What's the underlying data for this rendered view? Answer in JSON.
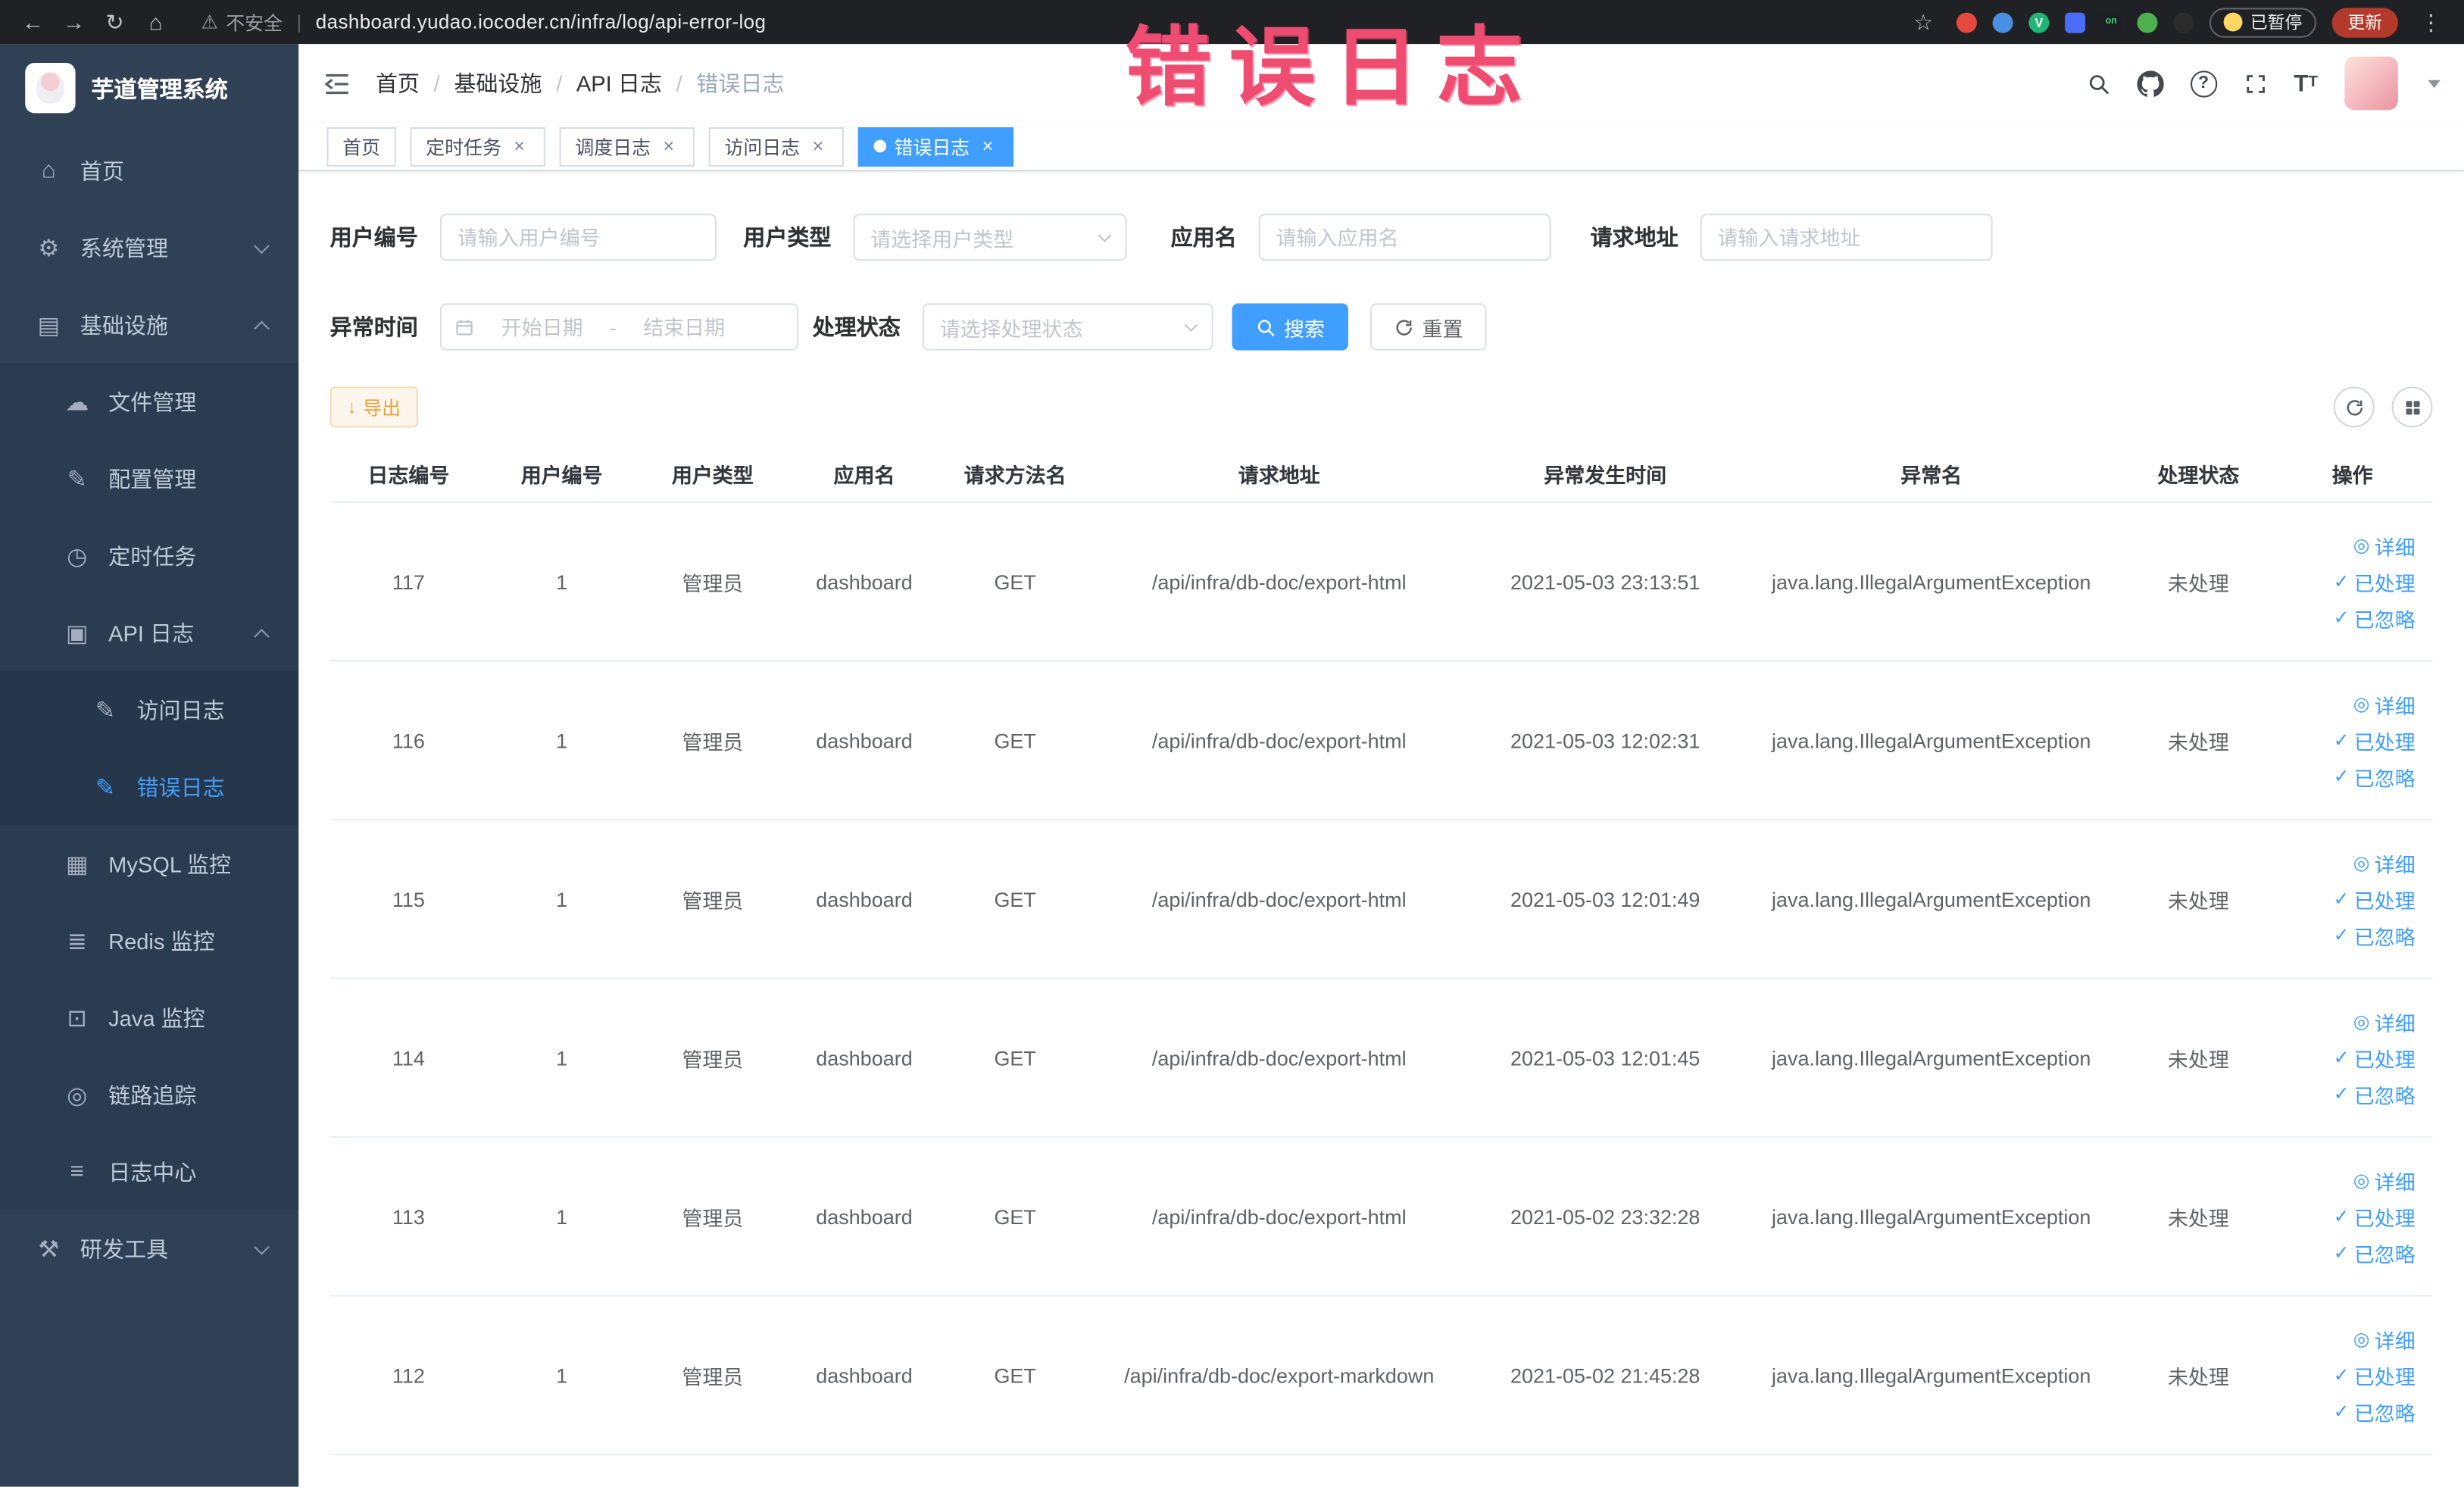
{
  "browser": {
    "security_label": "不安全",
    "url": "dashboard.yudao.iocoder.cn/infra/log/api-error-log",
    "paused_badge": "已暂停",
    "update_button": "更新"
  },
  "annotation": {
    "title": "错误日志"
  },
  "icons": {
    "back": "←",
    "forward": "→",
    "reload": "↻",
    "home": "⌂",
    "warning": "⚠",
    "star": "☆",
    "menu": "⋮",
    "divider": "|",
    "view": "◎",
    "check": "✓",
    "download": "↓"
  },
  "sidebar": {
    "logo_title": "芋道管理系统",
    "items": [
      {
        "label": "首页",
        "icon": "⌂"
      },
      {
        "label": "系统管理",
        "icon": "⚙"
      },
      {
        "label": "基础设施",
        "icon": "▤"
      },
      {
        "label": "文件管理",
        "icon": "☁"
      },
      {
        "label": "配置管理",
        "icon": "✎"
      },
      {
        "label": "定时任务",
        "icon": "◷"
      },
      {
        "label": "API 日志",
        "icon": "▣"
      },
      {
        "label": "访问日志",
        "icon": "✎"
      },
      {
        "label": "错误日志",
        "icon": "✎"
      },
      {
        "label": "MySQL 监控",
        "icon": "▦"
      },
      {
        "label": "Redis 监控",
        "icon": "≣"
      },
      {
        "label": "Java 监控",
        "icon": "⊡"
      },
      {
        "label": "链路追踪",
        "icon": "◎"
      },
      {
        "label": "日志中心",
        "icon": "≡"
      },
      {
        "label": "研发工具",
        "icon": "⚒"
      }
    ]
  },
  "breadcrumb": {
    "separator": "/",
    "items": [
      "首页",
      "基础设施",
      "API 日志",
      "错误日志"
    ]
  },
  "tabsbar": {
    "close_glyph": "×",
    "tabs": [
      {
        "label": "首页"
      },
      {
        "label": "定时任务"
      },
      {
        "label": "调度日志"
      },
      {
        "label": "访问日志"
      },
      {
        "label": "错误日志"
      }
    ]
  },
  "filters": {
    "user_id": {
      "label": "用户编号",
      "placeholder": "请输入用户编号"
    },
    "user_type": {
      "label": "用户类型",
      "placeholder": "请选择用户类型"
    },
    "app_name": {
      "label": "应用名",
      "placeholder": "请输入应用名"
    },
    "request_url": {
      "label": "请求地址",
      "placeholder": "请输入请求地址"
    },
    "exception_time": {
      "label": "异常时间",
      "start_placeholder": "开始日期",
      "separator": "-",
      "end_placeholder": "结束日期"
    },
    "process_status": {
      "label": "处理状态",
      "placeholder": "请选择处理状态"
    },
    "search_label": "搜索",
    "reset_label": "重置"
  },
  "toolbar": {
    "export_label": "导出"
  },
  "table": {
    "columns": [
      "日志编号",
      "用户编号",
      "用户类型",
      "应用名",
      "请求方法名",
      "请求地址",
      "异常发生时间",
      "异常名",
      "处理状态",
      "操作"
    ],
    "actions": {
      "detail": "详细",
      "processed": "已处理",
      "ignored": "已忽略"
    },
    "rows": [
      {
        "log_id": "117",
        "user_id": "1",
        "user_type": "管理员",
        "app_name": "dashboard",
        "method": "GET",
        "url": "/api/infra/db-doc/export-html",
        "time": "2021-05-03 23:13:51",
        "exception": "java.lang.IllegalArgumentException",
        "status": "未处理"
      },
      {
        "log_id": "116",
        "user_id": "1",
        "user_type": "管理员",
        "app_name": "dashboard",
        "method": "GET",
        "url": "/api/infra/db-doc/export-html",
        "time": "2021-05-03 12:02:31",
        "exception": "java.lang.IllegalArgumentException",
        "status": "未处理"
      },
      {
        "log_id": "115",
        "user_id": "1",
        "user_type": "管理员",
        "app_name": "dashboard",
        "method": "GET",
        "url": "/api/infra/db-doc/export-html",
        "time": "2021-05-03 12:01:49",
        "exception": "java.lang.IllegalArgumentException",
        "status": "未处理"
      },
      {
        "log_id": "114",
        "user_id": "1",
        "user_type": "管理员",
        "app_name": "dashboard",
        "method": "GET",
        "url": "/api/infra/db-doc/export-html",
        "time": "2021-05-03 12:01:45",
        "exception": "java.lang.IllegalArgumentException",
        "status": "未处理"
      },
      {
        "log_id": "113",
        "user_id": "1",
        "user_type": "管理员",
        "app_name": "dashboard",
        "method": "GET",
        "url": "/api/infra/db-doc/export-html",
        "time": "2021-05-02 23:32:28",
        "exception": "java.lang.IllegalArgumentException",
        "status": "未处理"
      },
      {
        "log_id": "112",
        "user_id": "1",
        "user_type": "管理员",
        "app_name": "dashboard",
        "method": "GET",
        "url": "/api/infra/db-doc/export-markdown",
        "time": "2021-05-02 21:45:28",
        "exception": "java.lang.IllegalArgumentException",
        "status": "未处理"
      }
    ]
  }
}
